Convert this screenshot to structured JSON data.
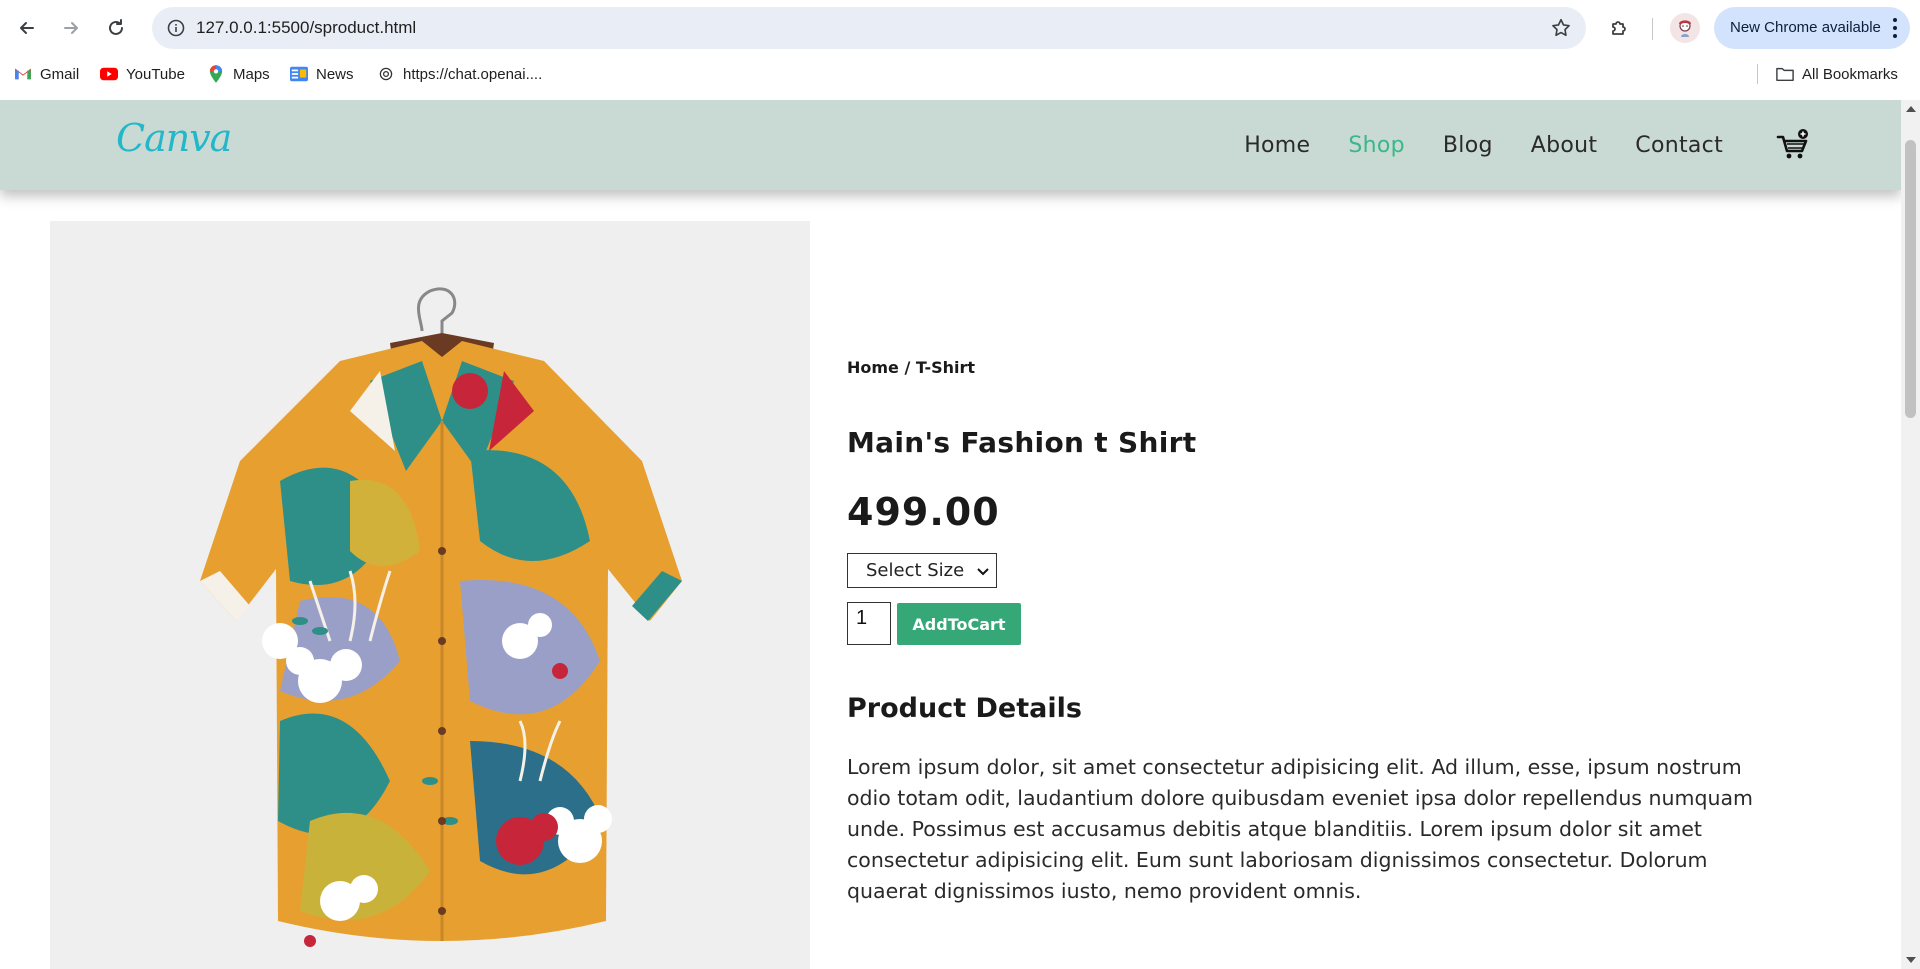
{
  "browser": {
    "url": "127.0.0.1:5500/sproduct.html",
    "update_label": "New Chrome available",
    "icons": {
      "back": "arrow-left-icon",
      "forward": "arrow-right-icon",
      "reload": "reload-icon",
      "site_info": "info-icon",
      "bookmark_star": "star-icon",
      "extensions": "puzzle-icon",
      "menu": "kebab-menu-icon"
    }
  },
  "bookmarks": {
    "items": [
      {
        "label": "Gmail",
        "icon": "gmail-icon"
      },
      {
        "label": "YouTube",
        "icon": "youtube-icon"
      },
      {
        "label": "Maps",
        "icon": "maps-icon"
      },
      {
        "label": "News",
        "icon": "news-icon"
      },
      {
        "label": "https://chat.openai....",
        "icon": "openai-icon"
      }
    ],
    "all_bookmarks": "All Bookmarks"
  },
  "site": {
    "logo": "Canva",
    "nav": [
      {
        "label": "Home",
        "active": false
      },
      {
        "label": "Shop",
        "active": true
      },
      {
        "label": "Blog",
        "active": false
      },
      {
        "label": "About",
        "active": false
      },
      {
        "label": "Contact",
        "active": false
      }
    ],
    "accent_color": "#39b889",
    "header_bg": "#c9d9d3"
  },
  "product": {
    "breadcrumb": "Home / T-Shirt",
    "title": "Main's Fashion t Shirt",
    "price": "499.00",
    "size_select": "Select Size",
    "quantity": "1",
    "add_to_cart": "AddToCart",
    "details_heading": "Product Details",
    "details_text": "Lorem ipsum dolor, sit amet consectetur adipisicing elit. Ad illum, esse, ipsum nostrum odio totam odit, laudantium dolore quibusdam eveniet ipsa dolor repellendus numquam unde. Possimus est accusamus debitis atque blanditiis. Lorem ipsum dolor sit amet consectetur adipisicing elit. Eum sunt laboriosam dignissimos consectetur. Dolorum quaerat dignissimos iusto, nemo provident omnis."
  }
}
